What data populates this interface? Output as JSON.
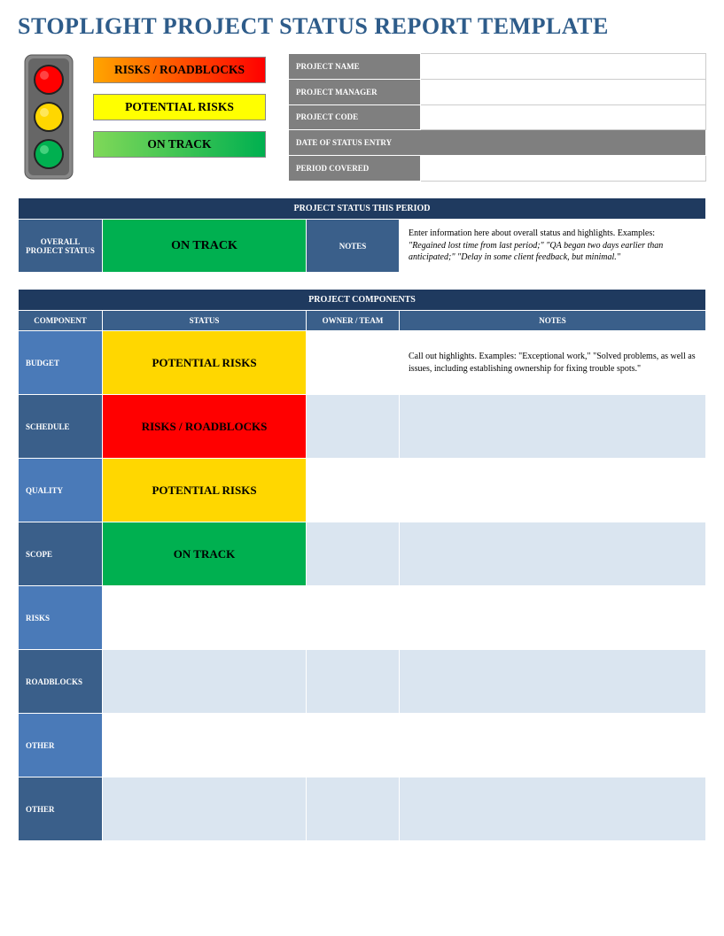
{
  "title": "STOPLIGHT PROJECT STATUS REPORT TEMPLATE",
  "legend": {
    "red": "RISKS / ROADBLOCKS",
    "yellow": "POTENTIAL RISKS",
    "green": "ON TRACK"
  },
  "info_fields": {
    "project_name": {
      "label": "PROJECT NAME",
      "value": ""
    },
    "project_manager": {
      "label": "PROJECT MANAGER",
      "value": ""
    },
    "project_code": {
      "label": "PROJECT CODE",
      "value": ""
    },
    "date_of_status_entry": {
      "label": "DATE OF STATUS ENTRY",
      "value": ""
    },
    "period_covered": {
      "label": "PERIOD COVERED",
      "value": ""
    }
  },
  "status_period": {
    "header": "PROJECT STATUS THIS PERIOD",
    "overall_label": "OVERALL PROJECT STATUS",
    "overall_status": "ON TRACK",
    "notes_label": "NOTES",
    "notes": "Enter information here about overall status and highlights. Examples:",
    "notes_italic": "\"Regained lost time from last period;\" \"QA began two days earlier than anticipated;\" \"Delay in some client feedback, but minimal.\""
  },
  "components": {
    "header": "PROJECT COMPONENTS",
    "columns": {
      "component": "COMPONENT",
      "status": "STATUS",
      "owner": "OWNER / TEAM",
      "notes": "NOTES"
    },
    "rows": [
      {
        "component": "BUDGET",
        "status": "POTENTIAL RISKS",
        "status_class": "yellow",
        "owner": "",
        "notes": "Call out highlights. Examples: \"Exceptional work,\" \"Solved problems, as well as issues, including establishing ownership for fixing trouble spots.\"",
        "alt": false
      },
      {
        "component": "SCHEDULE",
        "status": "RISKS / ROADBLOCKS",
        "status_class": "red",
        "owner": "",
        "notes": "",
        "alt": true
      },
      {
        "component": "QUALITY",
        "status": "POTENTIAL RISKS",
        "status_class": "yellow",
        "owner": "",
        "notes": "",
        "alt": false
      },
      {
        "component": "SCOPE",
        "status": "ON TRACK",
        "status_class": "green",
        "owner": "",
        "notes": "",
        "alt": true
      },
      {
        "component": "RISKS",
        "status": "",
        "status_class": "",
        "owner": "",
        "notes": "",
        "alt": false
      },
      {
        "component": "ROADBLOCKS",
        "status": "",
        "status_class": "",
        "owner": "",
        "notes": "",
        "alt": true
      },
      {
        "component": "OTHER",
        "status": "",
        "status_class": "",
        "owner": "",
        "notes": "",
        "alt": false
      },
      {
        "component": "OTHER",
        "status": "",
        "status_class": "",
        "owner": "",
        "notes": "",
        "alt": true
      }
    ]
  }
}
